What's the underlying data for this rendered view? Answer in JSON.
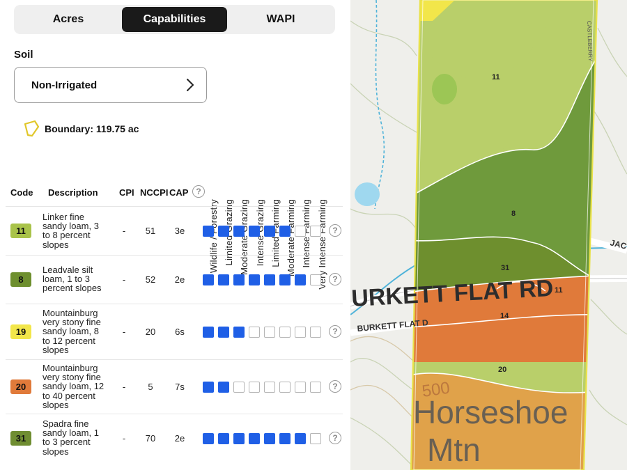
{
  "tabs": [
    {
      "label": "Acres",
      "active": false
    },
    {
      "label": "Capabilities",
      "active": true
    },
    {
      "label": "WAPI",
      "active": false
    }
  ],
  "soil": {
    "title": "Soil",
    "selector_value": "Non-Irrigated",
    "boundary_text": "Boundary: 119.75 ac"
  },
  "table": {
    "headers": {
      "code": "Code",
      "description": "Description",
      "cpi": "CPI",
      "nccpi": "NCCPI",
      "cap": "CAP"
    },
    "capability_headers": [
      "Wildlife / Forestry",
      "Limited Grazing",
      "Moderate Grazing",
      "Intense Grazing",
      "Limited Farming",
      "Moderate Farming",
      "Intense Farming",
      "Very Intense Farming"
    ],
    "rows": [
      {
        "code": "11",
        "color": "#a9c34a",
        "description": "Linker fine sandy loam, 3 to 8 percent slopes",
        "cpi": "-",
        "nccpi": "51",
        "cap": "3e",
        "filled": 6
      },
      {
        "code": "8",
        "color": "#6e8f2e",
        "description": "Leadvale silt loam, 1 to 3 percent slopes",
        "cpi": "-",
        "nccpi": "52",
        "cap": "2e",
        "filled": 7
      },
      {
        "code": "19",
        "color": "#f2e64a",
        "description": "Mountainburg very stony fine sandy loam, 8 to 12 percent slopes",
        "cpi": "-",
        "nccpi": "20",
        "cap": "6s",
        "filled": 3
      },
      {
        "code": "20",
        "color": "#e07a3a",
        "description": "Mountainburg very stony fine sandy loam, 12 to 40 percent slopes",
        "cpi": "-",
        "nccpi": "5",
        "cap": "7s",
        "filled": 2
      },
      {
        "code": "31",
        "color": "#6f8d31",
        "description": "Spadra fine sandy loam, 1 to 3 percent slopes",
        "cpi": "-",
        "nccpi": "70",
        "cap": "2e",
        "filled": 7
      }
    ]
  },
  "map": {
    "zone_labels": [
      "11",
      "8",
      "31",
      "11",
      "14",
      "20"
    ],
    "road_label_1": "URKETT FLAT RD",
    "road_label_2": "BURKETT FLAT D",
    "road_label_3": "JAC",
    "road_label_4": "CASTLEBERRY",
    "contour_label": "500",
    "place_name_1": "Horseshoe",
    "place_name_2": "Mtn"
  },
  "colors": {
    "accent_blue": "#1f5fe6",
    "active_tab": "#1a1a1a",
    "boundary_yellow": "#e9e24a"
  }
}
